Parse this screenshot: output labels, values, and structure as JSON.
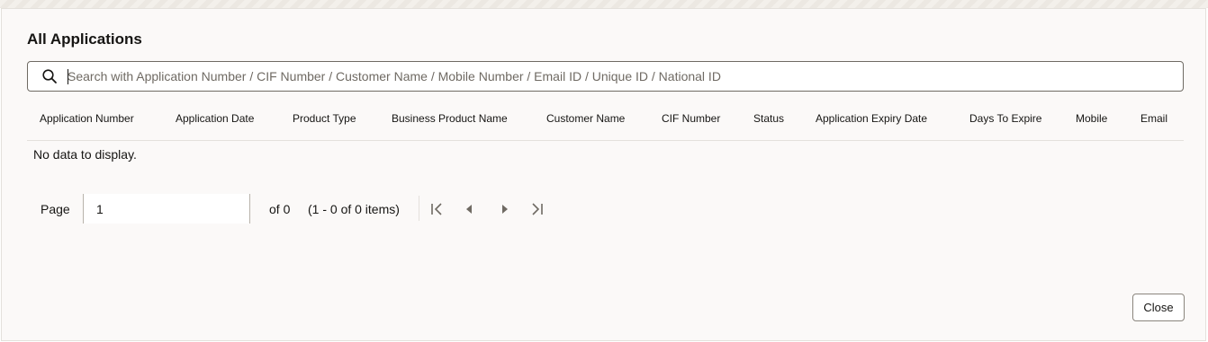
{
  "dialog": {
    "title": "All Applications"
  },
  "search": {
    "placeholder": "Search with Application Number / CIF Number / Customer Name / Mobile Number / Email ID / Unique ID / National ID",
    "value": "",
    "icon": "search-icon"
  },
  "table": {
    "columns": [
      "Application Number",
      "Application Date",
      "Product Type",
      "Business Product Name",
      "Customer Name",
      "CIF Number",
      "Status",
      "Application Expiry Date",
      "Days To Expire",
      "Mobile",
      "Email"
    ],
    "rows": [],
    "empty_message": "No data to display."
  },
  "pagination": {
    "page_label": "Page",
    "page_value": "1",
    "of_label": "of 0",
    "range_label": "(1 - 0 of 0 items)",
    "icons": [
      "first-page-icon",
      "previous-page-icon",
      "next-page-icon",
      "last-page-icon"
    ]
  },
  "footer": {
    "close_label": "Close"
  },
  "colors": {
    "dialog_bg": "#fbf9f8",
    "text": "#161513",
    "border": "#6f6a63",
    "divider": "#e4e1dc"
  }
}
